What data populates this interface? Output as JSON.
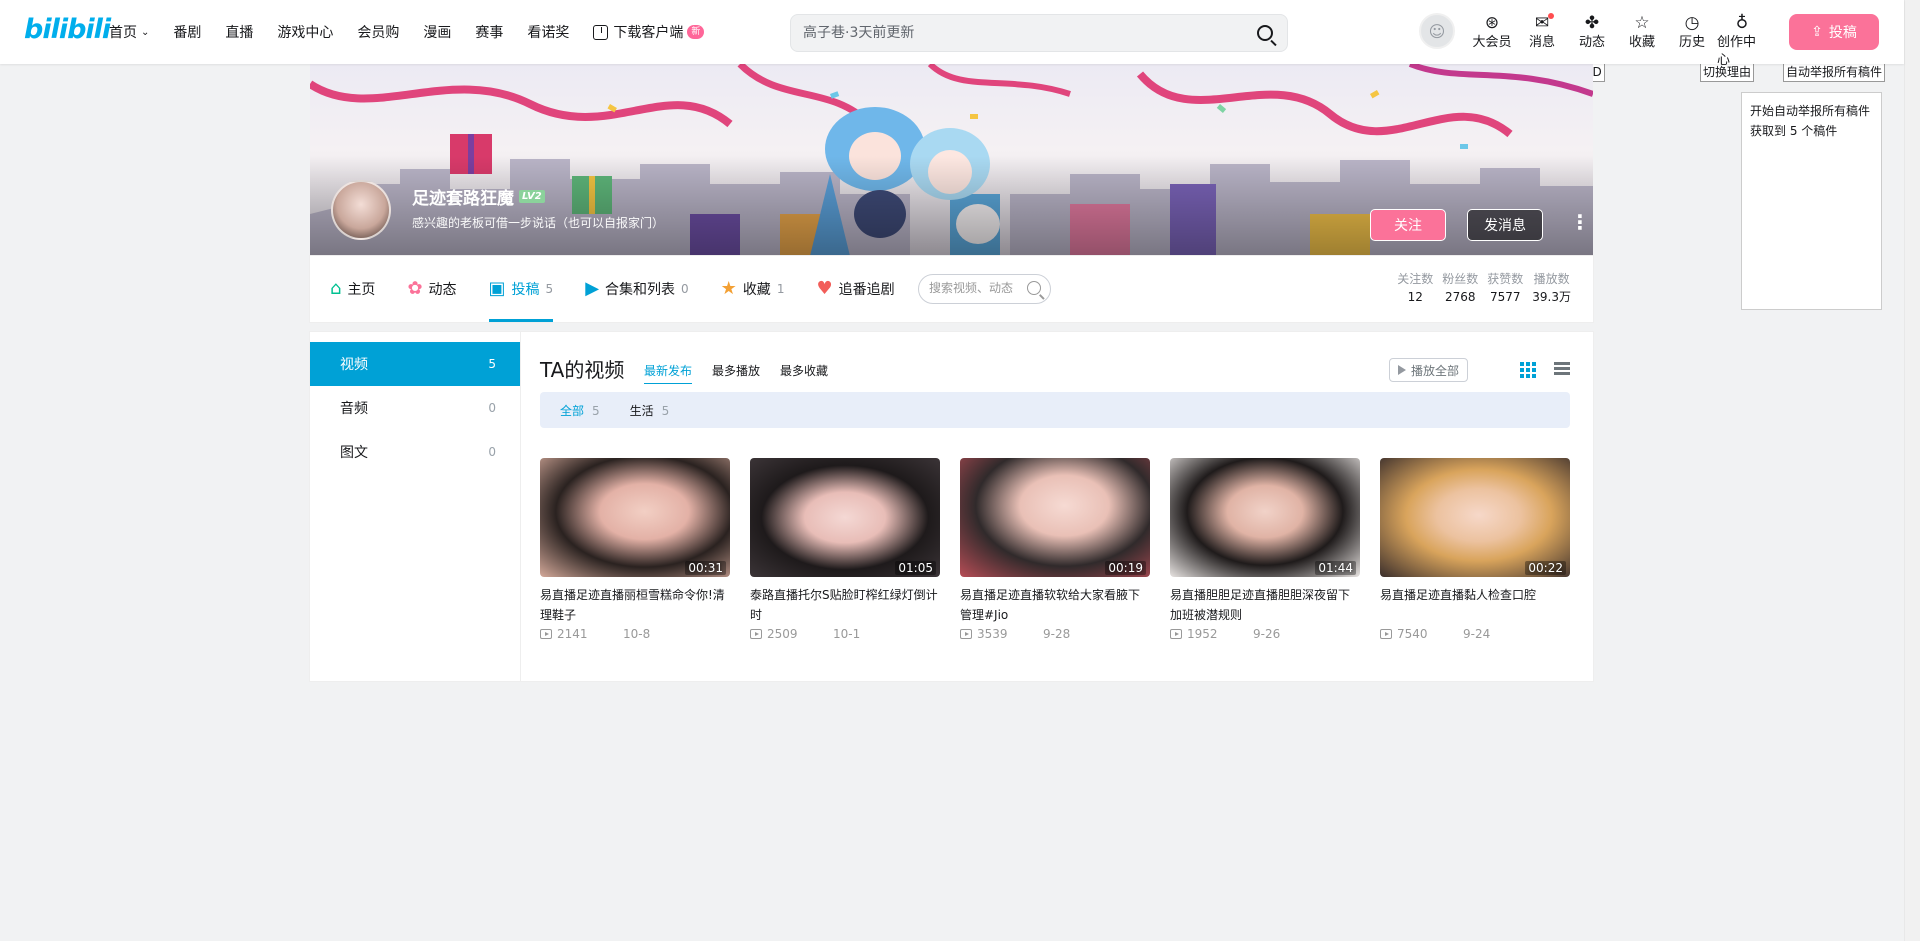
{
  "header": {
    "logo": "bilibili",
    "nav": [
      {
        "label": "首页",
        "icon": "chevron-down-icon"
      },
      {
        "label": "番剧"
      },
      {
        "label": "直播"
      },
      {
        "label": "游戏中心"
      },
      {
        "label": "会员购"
      },
      {
        "label": "漫画"
      },
      {
        "label": "赛事"
      },
      {
        "label": "看诺奖"
      },
      {
        "label": "下载客户端",
        "icon": "download-icon",
        "badge": "新"
      }
    ],
    "search_placeholder": "高子巷·3天前更新",
    "actions": [
      {
        "label": "大会员",
        "icon": "vip-icon"
      },
      {
        "label": "消息",
        "icon": "mail-icon",
        "has_dot": true
      },
      {
        "label": "动态",
        "icon": "fan-icon"
      },
      {
        "label": "收藏",
        "icon": "star-icon"
      },
      {
        "label": "历史",
        "icon": "clock-icon"
      },
      {
        "label": "创作中心",
        "icon": "bulb-icon"
      }
    ],
    "upload_label": "投稿",
    "accent": "#fb7299",
    "brand": "#00aeec"
  },
  "extension": {
    "copy_uid": "复制用户ID",
    "switch_reason": "切换理由",
    "auto_report": "自动举报所有稿件",
    "panel_line1": "开始自动举报所有稿件",
    "panel_line2": "获取到 5 个稿件"
  },
  "profile": {
    "name": "足迹套路狂魔",
    "level": "LV2",
    "sign": "感兴趣的老板可借一步说话（也可以自报家门）",
    "follow_label": "关注",
    "message_label": "发消息"
  },
  "tabs": [
    {
      "label": "主页",
      "icon": "home-icon",
      "count": "",
      "color": "#00c091"
    },
    {
      "label": "动态",
      "icon": "dynamic-icon",
      "count": "",
      "color": "#fb7299"
    },
    {
      "label": "投稿",
      "icon": "upload-icon",
      "count": "5",
      "color": "#00a1d6"
    },
    {
      "label": "合集和列表",
      "icon": "playlist-icon",
      "count": "0",
      "color": "#00a1d6"
    },
    {
      "label": "收藏",
      "icon": "favorite-icon",
      "count": "1",
      "color": "#f3a034"
    },
    {
      "label": "追番追剧",
      "icon": "heart-icon",
      "count": "",
      "color": "#f25d59"
    }
  ],
  "space_search_placeholder": "搜索视频、动态",
  "stats": [
    {
      "label": "关注数",
      "value": "12"
    },
    {
      "label": "粉丝数",
      "value": "2768"
    },
    {
      "label": "获赞数",
      "value": "7577"
    },
    {
      "label": "播放数",
      "value": "39.3万"
    }
  ],
  "side": [
    {
      "label": "视频",
      "count": "5"
    },
    {
      "label": "音频",
      "count": "0"
    },
    {
      "label": "图文",
      "count": "0"
    }
  ],
  "main": {
    "title": "TA的视频",
    "sorts": [
      "最新发布",
      "最多播放",
      "最多收藏"
    ],
    "play_all": "播放全部",
    "filters": [
      {
        "label": "全部",
        "count": "5"
      },
      {
        "label": "生活",
        "count": "5"
      }
    ]
  },
  "videos": [
    {
      "title": "易直播足迹直播丽桓雪糕命令你!清理鞋子",
      "duration": "00:31",
      "views": "2141",
      "date": "10-8"
    },
    {
      "title": "泰路直播托尔S贴脸盯榨红绿灯倒计时",
      "duration": "01:05",
      "views": "2509",
      "date": "10-1"
    },
    {
      "title": "易直播足迹直播软软给大家看腋下管理#Jio",
      "duration": "00:19",
      "views": "3539",
      "date": "9-28"
    },
    {
      "title": "易直播胆胆足迹直播胆胆深夜留下加班被潜规则",
      "duration": "01:44",
      "views": "1952",
      "date": "9-26"
    },
    {
      "title": "易直播足迹直播黏人检查口腔",
      "duration": "00:22",
      "views": "7540",
      "date": "9-24"
    }
  ]
}
